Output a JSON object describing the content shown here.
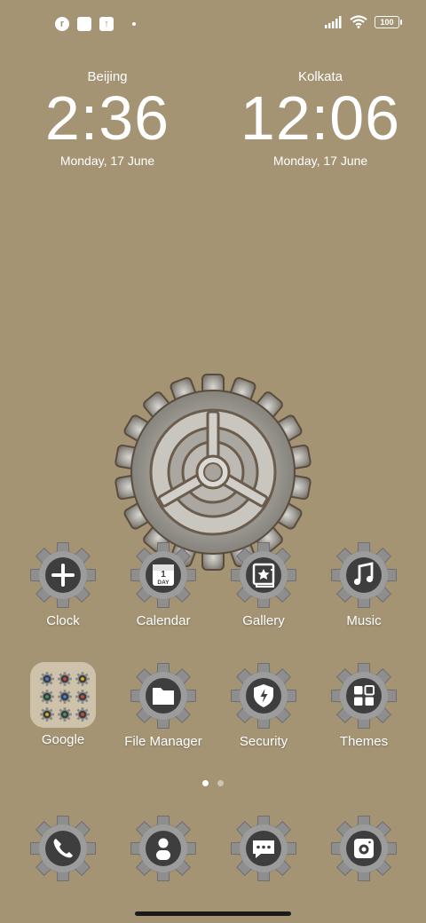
{
  "status_bar": {
    "left_icons": [
      "notification-app-icon",
      "square-notification-icon",
      "upload-notification-icon"
    ],
    "battery": "100",
    "right_icons": [
      "signal-icon",
      "wifi-icon",
      "battery-icon"
    ]
  },
  "clocks": [
    {
      "city": "Beijing",
      "time": "2:36",
      "date": "Monday, 17 June"
    },
    {
      "city": "Kolkata",
      "time": "12:06",
      "date": "Monday, 17 June"
    }
  ],
  "apps_row1": [
    {
      "label": "Clock",
      "icon": "clock-plus-icon"
    },
    {
      "label": "Calendar",
      "icon": "calendar-icon",
      "badge": "1",
      "badge_sub": "DAY"
    },
    {
      "label": "Gallery",
      "icon": "gallery-icon"
    },
    {
      "label": "Music",
      "icon": "music-note-icon"
    }
  ],
  "apps_row2": [
    {
      "label": "Google",
      "icon": "google-folder-icon"
    },
    {
      "label": "File Manager",
      "icon": "folder-icon"
    },
    {
      "label": "Security",
      "icon": "shield-icon"
    },
    {
      "label": "Themes",
      "icon": "themes-icon"
    }
  ],
  "folder_minis": [
    "G",
    "M",
    "P",
    "",
    "",
    "",
    "",
    "",
    ""
  ],
  "dock": [
    {
      "icon": "phone-icon"
    },
    {
      "icon": "contacts-icon"
    },
    {
      "icon": "messages-icon"
    },
    {
      "icon": "camera-icon"
    }
  ],
  "pager": {
    "pages": 2,
    "active": 0
  },
  "colors": {
    "wallpaper": "#a49474",
    "gear_metal": "#8e8e8e",
    "icon_disc": "#3e3e3e"
  }
}
